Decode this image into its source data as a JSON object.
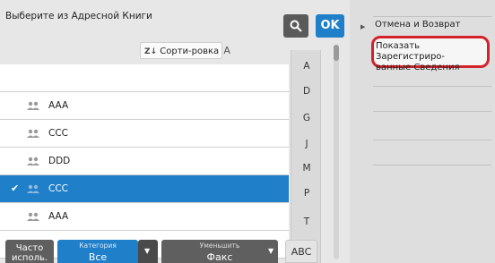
{
  "header": {
    "title": "Выберите из Адресной Книги",
    "ok_label": "OK",
    "sort_label": "Сорти-ровка",
    "sort_prefix": "Z↓",
    "sort_suffix": "A"
  },
  "contacts": [
    {
      "name": "AAA",
      "selected": false
    },
    {
      "name": "CCC",
      "selected": false
    },
    {
      "name": "DDD",
      "selected": false
    },
    {
      "name": "CCC",
      "selected": true
    },
    {
      "name": "AAA",
      "selected": false
    }
  ],
  "alphabet": [
    "A",
    "D",
    "G",
    "J",
    "M",
    "P",
    "T",
    "W"
  ],
  "bottom": {
    "frequent_label_1": "Часто",
    "frequent_label_2": "исполь.",
    "category_caption": "Категория",
    "category_value": "Все",
    "reduce_caption": "Уменьшить",
    "reduce_value": "Факс",
    "abc_label": "ABC"
  },
  "right_panel": {
    "cancel_label": "Отмена и Возврат",
    "show_label_1": "Показать Зарегистриро-",
    "show_label_2": "ванные Сведения"
  },
  "colors": {
    "accent": "#1f7fc9",
    "highlight": "#d2232a"
  }
}
